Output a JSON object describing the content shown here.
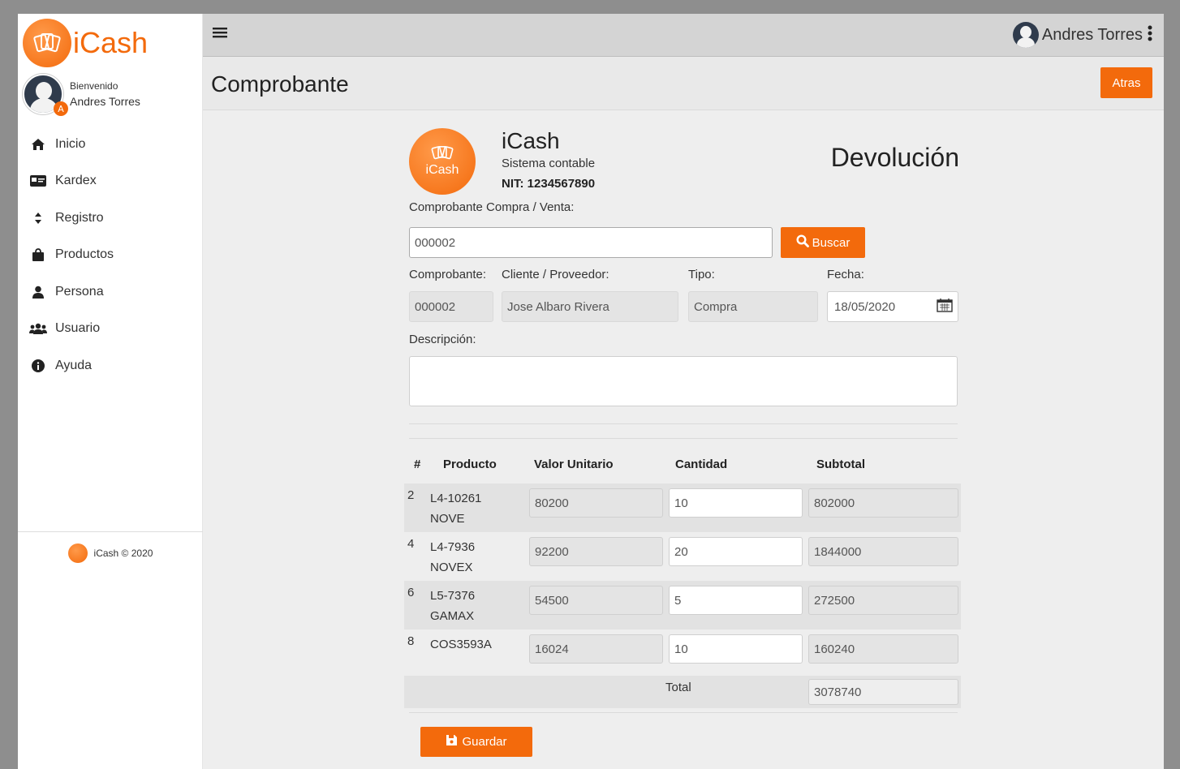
{
  "sidebar": {
    "brand": "iCash",
    "logo_text": "iCash",
    "welcome": "Bienvenido",
    "user_name": "Andres Torres",
    "avatar_badge": "A",
    "items": [
      {
        "label": "Inicio",
        "icon": "home-icon"
      },
      {
        "label": "Kardex",
        "icon": "id-card-icon"
      },
      {
        "label": "Registro",
        "icon": "sort-icon"
      },
      {
        "label": "Productos",
        "icon": "shopping-bag-icon"
      },
      {
        "label": "Persona",
        "icon": "user-icon"
      },
      {
        "label": "Usuario",
        "icon": "users-icon"
      },
      {
        "label": "Ayuda",
        "icon": "info-icon"
      }
    ],
    "footer": "iCash © 2020"
  },
  "topbar": {
    "menu_icon": "hamburger-icon",
    "user_name": "Andres Torres",
    "kebab_icon": "kebab-menu-icon"
  },
  "header": {
    "title": "Comprobante",
    "back_button": "Atras"
  },
  "company": {
    "logo_text": "iCash",
    "name": "iCash",
    "subtitle": "Sistema contable",
    "nit": "NIT: 1234567890",
    "doc_type": "Devolución"
  },
  "form": {
    "search_label": "Comprobante Compra / Venta:",
    "search_value": "000002",
    "search_button": "Buscar",
    "comprobante_label": "Comprobante:",
    "comprobante_value": "000002",
    "cliente_label": "Cliente / Proveedor:",
    "cliente_value": "Jose Albaro Rivera",
    "tipo_label": "Tipo:",
    "tipo_value": "Compra",
    "fecha_label": "Fecha:",
    "fecha_value": "18/05/2020",
    "descripcion_label": "Descripción:",
    "descripcion_value": ""
  },
  "table": {
    "headers": [
      "#",
      "Producto",
      "Valor Unitario",
      "Cantidad",
      "Subtotal"
    ],
    "rows": [
      {
        "num": "2",
        "product_line1": "L4-10261",
        "product_line2": "NOVE",
        "unit_price": "80200",
        "qty": "10",
        "subtotal": "802000"
      },
      {
        "num": "4",
        "product_line1": "L4-7936",
        "product_line2": "NOVEX",
        "unit_price": "92200",
        "qty": "20",
        "subtotal": "1844000"
      },
      {
        "num": "6",
        "product_line1": "L5-7376",
        "product_line2": "GAMAX",
        "unit_price": "54500",
        "qty": "5",
        "subtotal": "272500"
      },
      {
        "num": "8",
        "product_line1": "COS3593A",
        "product_line2": "",
        "unit_price": "16024",
        "qty": "10",
        "subtotal": "160240"
      }
    ],
    "total_label": "Total",
    "total_value": "3078740"
  },
  "actions": {
    "save_button": "Guardar"
  },
  "colors": {
    "accent": "#f36a0c",
    "topbar": "#d4d4d4",
    "content_bg": "#eeeeee"
  }
}
